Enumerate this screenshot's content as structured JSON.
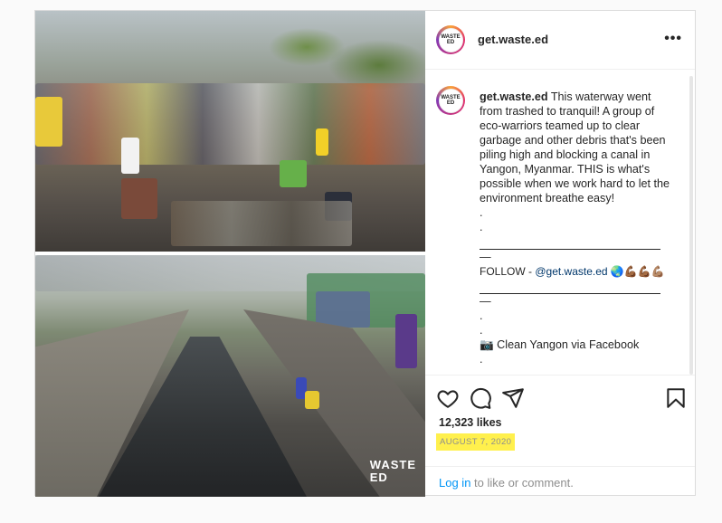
{
  "post": {
    "username": "get.waste.ed",
    "avatar_text": "WASTE ED",
    "more_label": "•••",
    "caption": {
      "username": "get.waste.ed",
      "text": " This waterway went from trashed to tranquil! A group of eco-warriors teamed up to clear garbage and other debris that's been piling high and blocking a canal in Yangon, Myanmar. THIS is what's possible when we work hard to let the environment breathe easy!",
      "dot": ".",
      "dash": "—",
      "follow_prefix": "FOLLOW - ",
      "follow_mention": "@get.waste.ed",
      "follow_emojis": " 🌏💪🏾💪🏾💪🏽",
      "credit": "📷 Clean Yangon via Facebook"
    },
    "likes": "12,323 likes",
    "date": "August 7, 2020",
    "login_link": "Log in",
    "login_rest": " to like or comment.",
    "watermark_line1": "WASTE",
    "watermark_line2": "ED"
  },
  "icons": {
    "like": "heart-icon",
    "comment": "comment-icon",
    "share": "share-icon",
    "save": "bookmark-icon"
  },
  "colors": {
    "highlight": "#fff04d",
    "link": "#0095f6",
    "mention": "#00376b"
  }
}
